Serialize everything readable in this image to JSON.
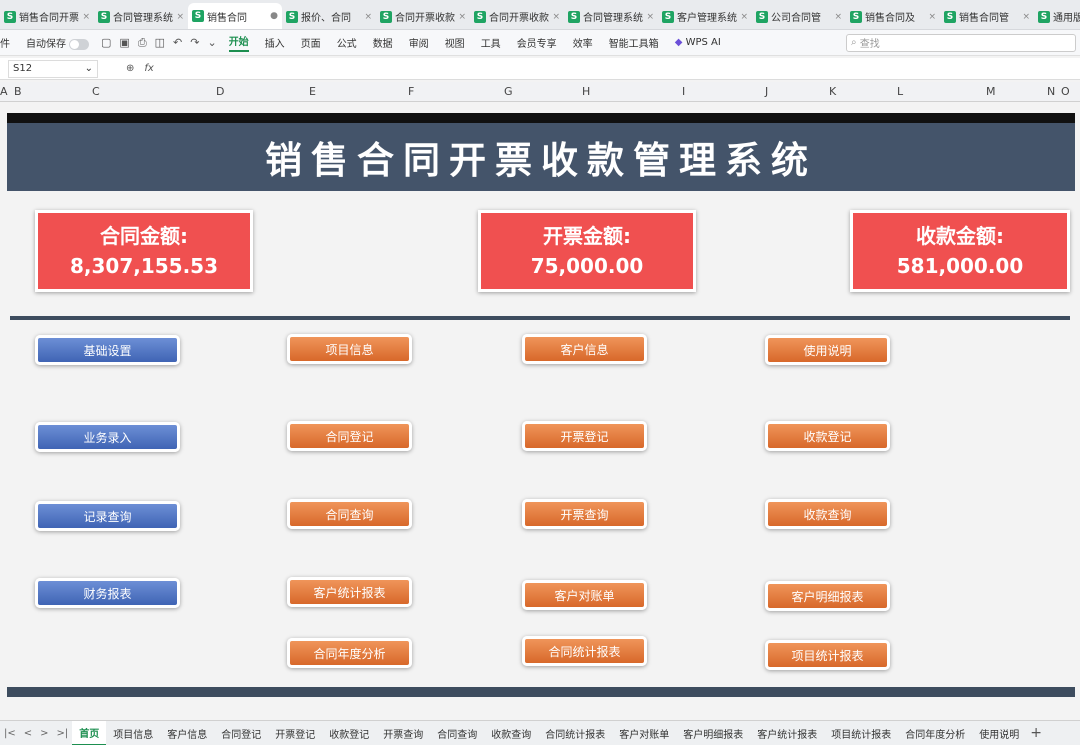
{
  "tabs": [
    {
      "label": "销售合同开票"
    },
    {
      "label": "合同管理系统"
    },
    {
      "label": "销售合同"
    },
    {
      "label": "报价、合同"
    },
    {
      "label": "合同开票收款"
    },
    {
      "label": "合同开票收款"
    },
    {
      "label": "合同管理系统"
    },
    {
      "label": "客户管理系统"
    },
    {
      "label": "公司合同管"
    },
    {
      "label": "销售合同及"
    },
    {
      "label": "销售合同管"
    },
    {
      "label": "通用版销"
    }
  ],
  "menu": {
    "file": "件",
    "autosave": "自动保存",
    "items": [
      "开始",
      "插入",
      "页面",
      "公式",
      "数据",
      "审阅",
      "视图",
      "工具",
      "会员专享",
      "效率",
      "智能工具箱"
    ],
    "wps_ai": "WPS AI",
    "search_placeholder": "查找"
  },
  "formula": {
    "cell": "S12",
    "fx": "fx"
  },
  "columns": [
    "A",
    "B",
    "C",
    "D",
    "E",
    "F",
    "G",
    "H",
    "I",
    "J",
    "K",
    "L",
    "M",
    "N",
    "O"
  ],
  "title": "销售合同开票收款管理系统",
  "cards": [
    {
      "label": "合同金额:",
      "value": "8,307,155.53"
    },
    {
      "label": "开票金额:",
      "value": "75,000.00"
    },
    {
      "label": "收款金额:",
      "value": "581,000.00"
    }
  ],
  "buttons": {
    "col1": [
      "基础设置",
      "业务录入",
      "记录查询",
      "财务报表"
    ],
    "col2": [
      "项目信息",
      "合同登记",
      "合同查询",
      "客户统计报表",
      "合同年度分析"
    ],
    "col3": [
      "客户信息",
      "开票登记",
      "开票查询",
      "客户对账单",
      "合同统计报表"
    ],
    "col4": [
      "使用说明",
      "收款登记",
      "收款查询",
      "客户明细报表",
      "项目统计报表"
    ]
  },
  "sheet_tabs": [
    "首页",
    "项目信息",
    "客户信息",
    "合同登记",
    "开票登记",
    "收款登记",
    "开票查询",
    "合同查询",
    "收款查询",
    "合同统计报表",
    "客户对账单",
    "客户明细报表",
    "客户统计报表",
    "项目统计报表",
    "合同年度分析",
    "使用说明"
  ],
  "colors": {
    "banner": "#44546a",
    "card": "#f05050",
    "blue_button": "#4a6fc0",
    "orange_button": "#e07a3a",
    "accent": "#1d8f50"
  }
}
